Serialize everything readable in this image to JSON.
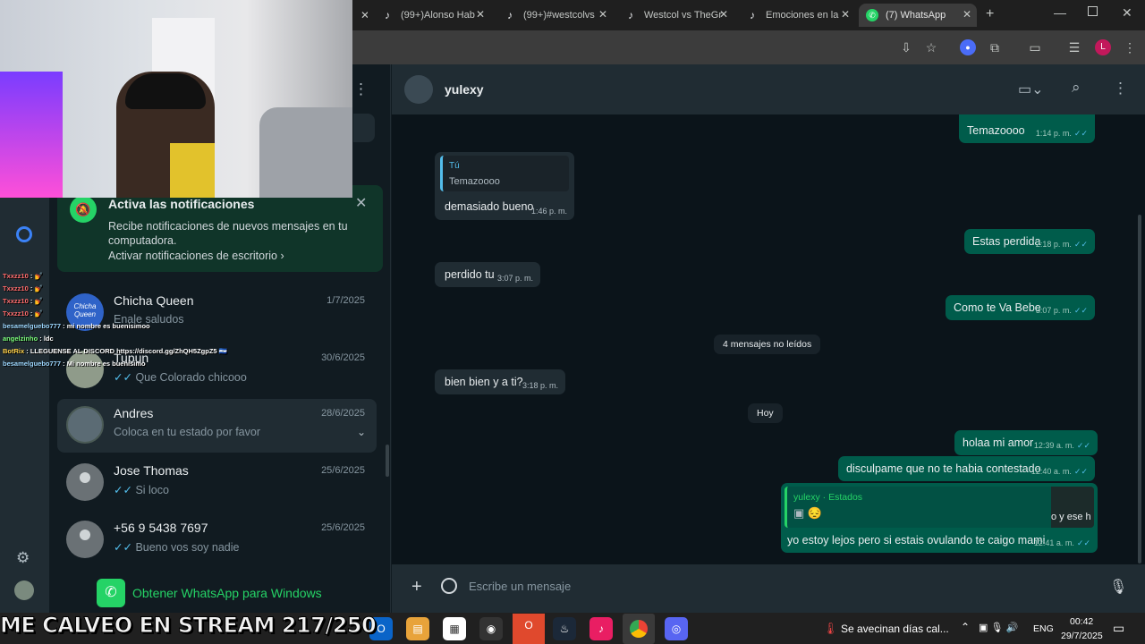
{
  "browser": {
    "tabs": [
      {
        "label": "(99+)Alonso Hab",
        "icon": "tiktok-icon"
      },
      {
        "label": "(99+)#westcolvs",
        "icon": "tiktok-icon"
      },
      {
        "label": "Westcol vs TheGr",
        "icon": "tiktok-icon"
      },
      {
        "label": "Emociones en la",
        "icon": "tiktok-icon"
      },
      {
        "label": "(7) WhatsApp",
        "icon": "whatsapp-icon"
      }
    ],
    "new_tab": "+",
    "profile_initial": "L"
  },
  "notification": {
    "title": "Activa las notificaciones",
    "body": "Recibe notificaciones de nuevos mensajes en tu computadora.",
    "link": "Activar notificaciones de escritorio"
  },
  "chats": [
    {
      "name": "Chicha Queen",
      "date": "1/7/2025",
      "last": "Enale saludos",
      "avatar_text": "Chicha Queen",
      "ticks": ""
    },
    {
      "name": "Tupun",
      "date": "30/6/2025",
      "last": "Que Colorado chicooo",
      "ticks": "✓✓"
    },
    {
      "name": "Andres",
      "date": "28/6/2025",
      "last": "Coloca en tu estado por favor",
      "ticks": ""
    },
    {
      "name": "Jose Thomas",
      "date": "25/6/2025",
      "last": "Si loco",
      "ticks": "✓✓"
    },
    {
      "name": "+56 9 5438 7697",
      "date": "25/6/2025",
      "last": "Bueno vos soy nadie",
      "ticks": "✓✓"
    }
  ],
  "get_app": "Obtener WhatsApp para Windows",
  "contact": {
    "name": "yulexy"
  },
  "messages": [
    {
      "dir": "out",
      "text": "Temazoooo",
      "time": "1:14 p. m."
    },
    {
      "dir": "in",
      "quote_author": "Tú",
      "quote_text": "Temazoooo",
      "text": "demasiado bueno",
      "time": "1:46 p. m."
    },
    {
      "dir": "out",
      "text": "Estas perdida",
      "time": "2:18 p. m."
    },
    {
      "dir": "in",
      "text": "perdido tu",
      "time": "3:07 p. m."
    },
    {
      "dir": "out",
      "text": "Como te Va Bebe",
      "time": "3:07 p. m."
    },
    {
      "dir": "in",
      "text": "bien bien y a ti?",
      "time": "3:18 p. m."
    },
    {
      "dir": "out",
      "text": "holaa mi amor",
      "time": "12:39 a. m."
    },
    {
      "dir": "out",
      "text": "disculpame que no te habia contestado",
      "time": "12:40 a. m."
    },
    {
      "dir": "out",
      "quote_author": "yulexy · Estados",
      "quote_text": "😔",
      "quote_thumb": "o y ese h",
      "text": "yo estoy lejos pero si estais ovulando te caigo mami",
      "time": "12:41 a. m."
    }
  ],
  "unread_divider": "4 mensajes no leídos",
  "day_divider": "Hoy",
  "composer": {
    "placeholder": "Escribe un mensaje"
  },
  "stream_chat": [
    {
      "user": "Txxzz10",
      "text": ": 💅"
    },
    {
      "user": "Txxzz10",
      "text": ": 💅"
    },
    {
      "user": "Txxzz10",
      "text": ": 💅"
    },
    {
      "user": "Txxzz10",
      "text": ": 💅"
    },
    {
      "user": "besamelguebo777",
      "text": ": mi nombre es buenisimoo"
    },
    {
      "user": "angelzinho",
      "text": ": ldc"
    },
    {
      "user": "BotRix",
      "text": ": LLEGUENSE AL DISCORD https://discord.gg/ZhQH5ZgpZ5 🇸🇻"
    },
    {
      "user": "besamelguebo777",
      "text": ": Mi nombre es buenisimo"
    }
  ],
  "stream_overlay": "ME CALVEO EN STREAM 217/250",
  "taskbar": {
    "weather": "Se avecinan días cal...",
    "lang": "ENG",
    "time": "00:42",
    "date": "29/7/2025"
  },
  "colors": {
    "whatsapp_green": "#25d366",
    "outgoing": "#005c4b",
    "incoming": "#202c33",
    "background": "#0b141a"
  }
}
